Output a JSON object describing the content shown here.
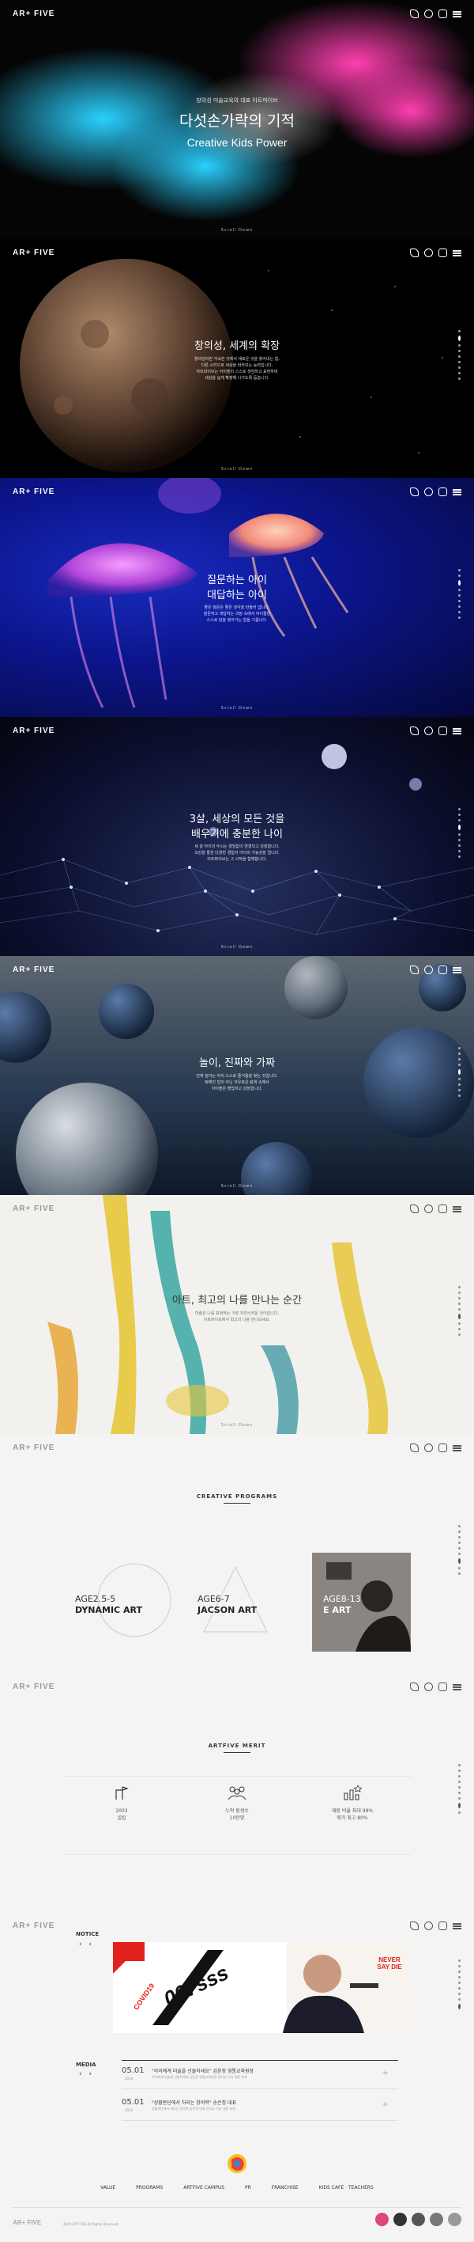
{
  "brand": {
    "logo_text": "AR+ FIVE"
  },
  "sections": {
    "hero": {
      "kicker": "창의성 미술교육의 대표 아트파이브",
      "title": "다섯손가락의 기적",
      "subtitle": "Creative Kids Power",
      "scroll": "Scroll Down"
    },
    "creativity": {
      "title": "창의성, 세계의 확장",
      "body": [
        "창의성이란 익숙한 것에서 새로운 것을 찾아내는 힘,",
        "다른 시각으로 세상을 바라보는 능력입니다.",
        "아트파이브는 아이들이 스스로 생각하고 표현하며",
        "세상을 넓게 확장해 나가도록 돕습니다."
      ],
      "scroll": "Scroll Down"
    },
    "question": {
      "title_line1": "질문하는 아이",
      "title_line2": "대답하는 아이",
      "body": [
        "좋은 질문은 좋은 생각을 만들어 냅니다.",
        "질문하고 대답하는 과정 속에서 아이들은",
        "스스로 답을 찾아가는 힘을 기릅니다."
      ],
      "scroll": "Scroll Down"
    },
    "age3": {
      "title_line1": "3살, 세상의 모든 것을",
      "title_line2": "배우기에 충분한 나이",
      "body": [
        "세 살 아이의 두뇌는 끊임없이 연결되고 성장합니다.",
        "오감을 통한 다양한 경험이 아이의 가능성을 엽니다.",
        "아트파이브는 그 시작을 함께합니다."
      ],
      "scroll": "Scroll Down"
    },
    "play": {
      "title": "놀이, 진짜와 가짜",
      "body": [
        "진짜 놀이는 아이 스스로 즐거움을 찾는 것입니다.",
        "정해진 답이 아닌 자유로운 탐색 속에서",
        "아이들은 몰입하고 성장합니다."
      ],
      "scroll": "Scroll Down"
    },
    "best": {
      "title": "아트, 최고의 나를 만나는 순간",
      "body": [
        "미술은 나를 표현하는 가장 자연스러운 언어입니다.",
        "아트파이브에서 최고의 나를 만나보세요."
      ],
      "scroll": "Scroll Down"
    },
    "programs": {
      "label": "CREATIVE PROGRAMS",
      "items": [
        {
          "age": "AGE2.5-5",
          "name": "DYNAMIC ART"
        },
        {
          "age": "AGE6-7",
          "name": "JACSON ART"
        },
        {
          "age": "AGE8-13",
          "name": "E ART"
        }
      ]
    },
    "merit": {
      "label": "ARTFIVE MERIT",
      "items": [
        {
          "line1": "2003",
          "line2": "설립"
        },
        {
          "line1": "누적 원생수",
          "line2": "10만명"
        },
        {
          "line1": "재원 비율 최대 99%",
          "line2": "평가 최고 80%"
        }
      ]
    },
    "notice": {
      "label": "NOTICE",
      "banner_left": "COVID19",
      "banner_main": "007sss",
      "banner_right": "NEVER SAY DIE"
    },
    "media": {
      "label": "MEDIA",
      "items": [
        {
          "date": "05.01",
          "year": "2020",
          "title": "\"아이에게 미술을 선물하세요\" 김윤정 영통교육원장",
          "desc": "아이에게 미술을 선물하세요 김윤정 영통교육원장 인터뷰 기사 내용 요약"
        },
        {
          "date": "05.01",
          "year": "2020",
          "title": "\"상황판단에서 처리는 창의력\" 송은정 대표",
          "desc": "상황판단에서 처리는 창의력 송은정 대표 인터뷰 기사 내용 요약"
        }
      ]
    },
    "footer": {
      "menu": [
        "VALUE",
        "PROGRAMS",
        "ARTFIVE CAMPUS",
        "PR",
        "FRANCHISE",
        "KIDS CAFE · TEACHERS"
      ],
      "copyright": "2020 ART FIVE All Rights Reserved.",
      "social": [
        "youtube",
        "instagram",
        "blog",
        "kakao",
        "facebook"
      ]
    }
  }
}
